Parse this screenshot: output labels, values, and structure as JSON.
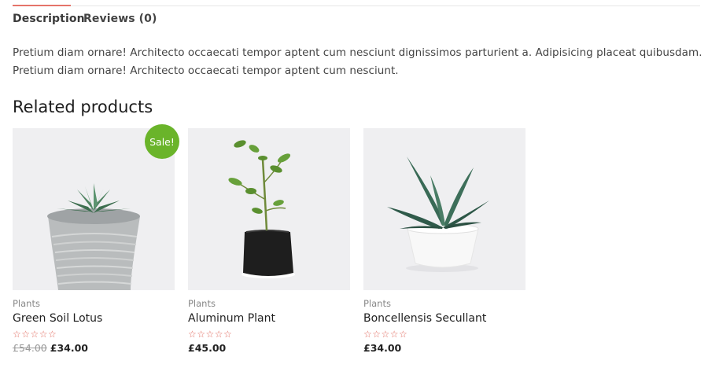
{
  "tabs": [
    {
      "label": "Description"
    },
    {
      "label": "Reviews (0)"
    }
  ],
  "description": "Pretium diam ornare! Architecto occaecati tempor aptent cum nesciunt dignissimos parturient a. Adipisicing placeat quibusdam. Pretium diam ornare! Architecto occaecati tempor aptent cum nesciunt.",
  "related_title": "Related products",
  "colors": {
    "accent": "#e5736a",
    "sale_badge": "#6ab42a",
    "stars": "#e0675b"
  },
  "products": [
    {
      "category": "Plants",
      "name": "Green Soil Lotus",
      "stars": "☆☆☆☆☆",
      "old_price": "£54.00",
      "price": "£34.00",
      "badge": "Sale!",
      "image_icon": "succulent-pot-image"
    },
    {
      "category": "Plants",
      "name": "Aluminum Plant",
      "stars": "☆☆☆☆☆",
      "price": "£45.00",
      "image_icon": "sapling-bag-image"
    },
    {
      "category": "Plants",
      "name": "Boncellensis Secullant",
      "stars": "☆☆☆☆☆",
      "price": "£34.00",
      "image_icon": "aloe-pot-image"
    }
  ]
}
